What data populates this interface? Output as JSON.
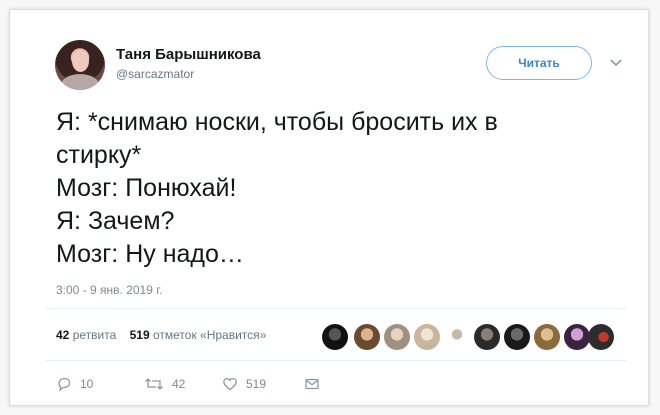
{
  "author": {
    "name": "Таня Барышникова",
    "handle": "@sarcazmator"
  },
  "follow_button": "Читать",
  "tweet": {
    "text": "Я: *снимаю носки, чтобы бросить их в\nстирку*\nМозг: Понюхай!\nЯ: Зачем?\nМозг: Ну надо…",
    "timestamp": "3:00 - 9 янв. 2019 г."
  },
  "stats": {
    "retweets_count": "42",
    "retweets_label": "ретвита",
    "likes_count": "519",
    "likes_label": "отметок «Нравится»"
  },
  "actions": {
    "replies": "10",
    "retweets": "42",
    "likes": "519"
  },
  "colors": {
    "accent": "#3a86c6",
    "muted": "#657786"
  },
  "icons": [
    "chevron-down-icon",
    "reply-icon",
    "retweet-icon",
    "like-icon",
    "message-icon"
  ]
}
